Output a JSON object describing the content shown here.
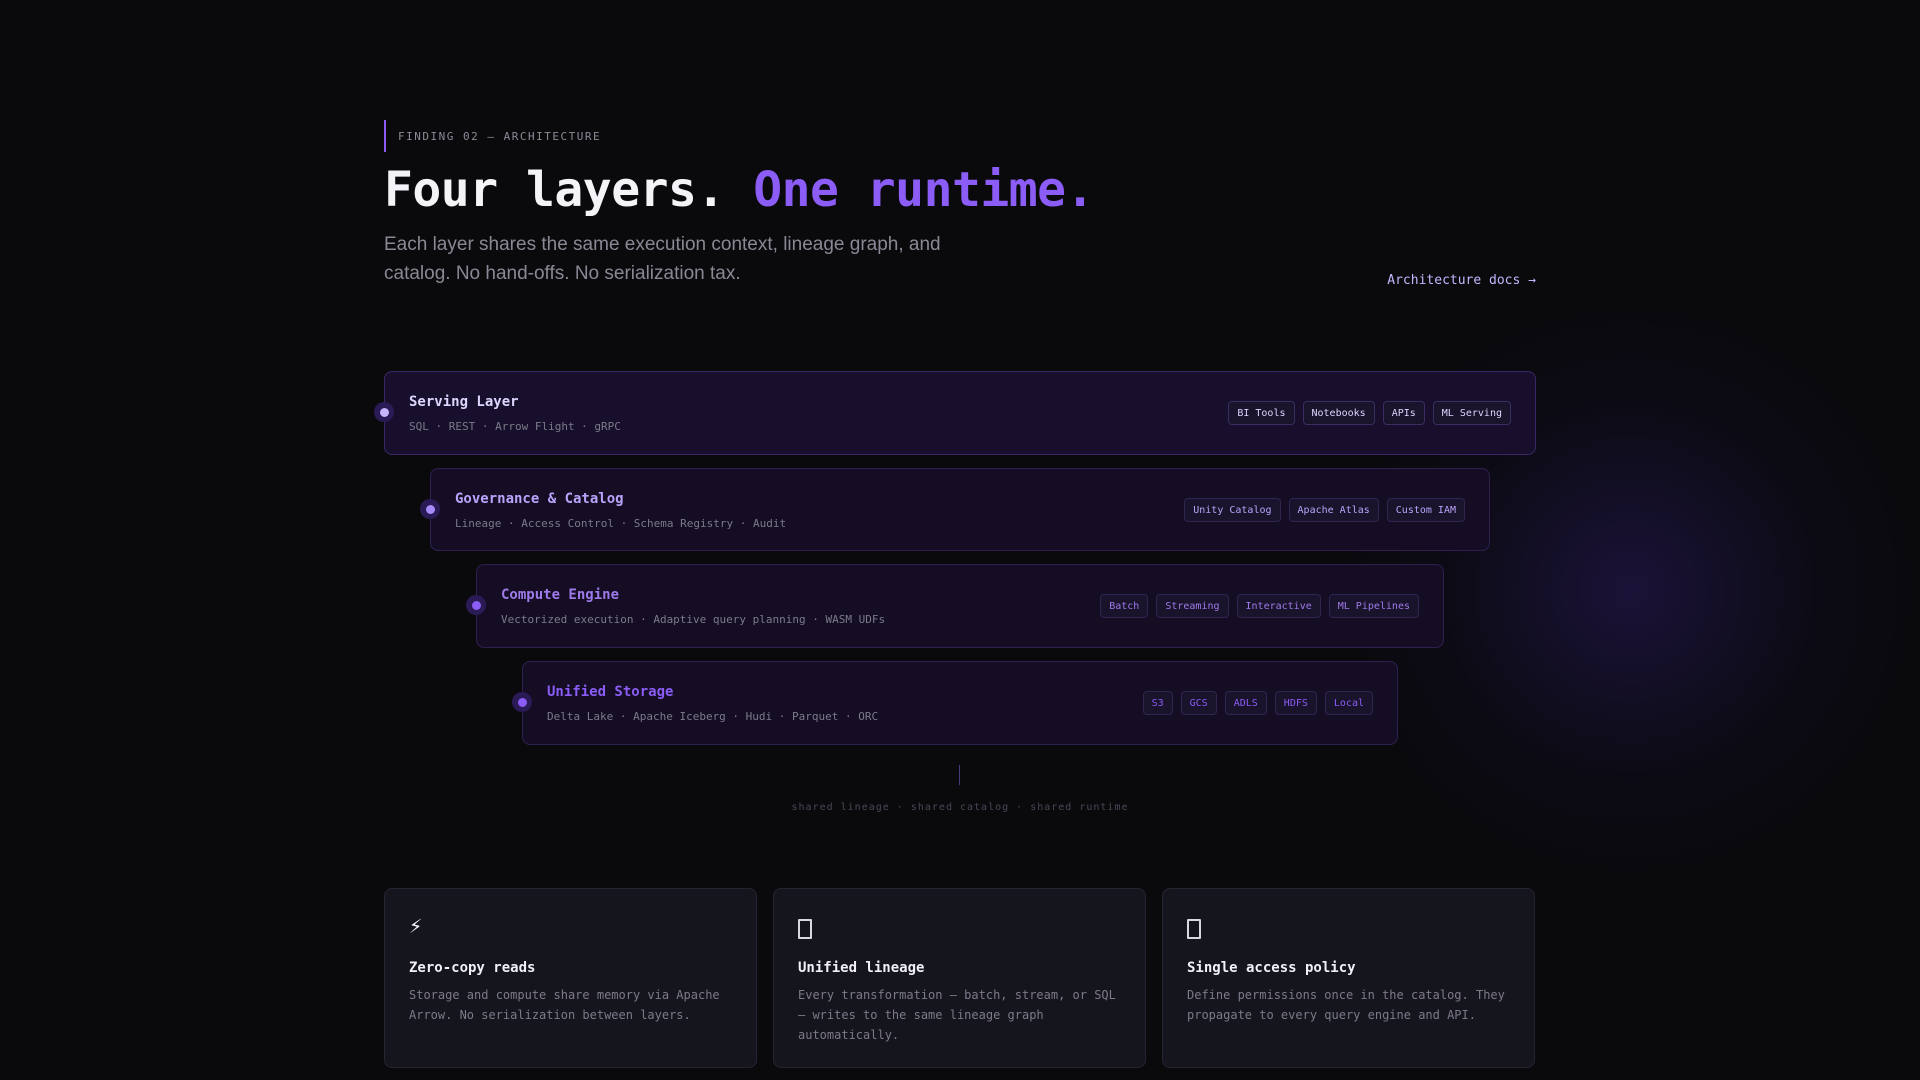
{
  "header": {
    "eyebrow": "FINDING 02 — ARCHITECTURE",
    "headline_plain": "Four layers.",
    "headline_accent": "One runtime.",
    "subhead": "Each layer shares the same execution context, lineage graph, and catalog. No hand-offs. No serialization tax.",
    "docs_link": "Architecture docs →"
  },
  "layers": [
    {
      "title": "Serving Layer",
      "subtitle": "SQL · REST · Arrow Flight · gRPC",
      "tags": [
        "BI Tools",
        "Notebooks",
        "APIs",
        "ML Serving"
      ]
    },
    {
      "title": "Governance & Catalog",
      "subtitle": "Lineage · Access Control · Schema Registry · Audit",
      "tags": [
        "Unity Catalog",
        "Apache Atlas",
        "Custom IAM"
      ]
    },
    {
      "title": "Compute Engine",
      "subtitle": "Vectorized execution · Adaptive query planning · WASM UDFs",
      "tags": [
        "Batch",
        "Streaming",
        "Interactive",
        "ML Pipelines"
      ]
    },
    {
      "title": "Unified Storage",
      "subtitle": "Delta Lake · Apache Iceberg · Hudi · Parquet · ORC",
      "tags": [
        "S3",
        "GCS",
        "ADLS",
        "HDFS",
        "Local"
      ]
    }
  ],
  "shared_caption": "shared lineage · shared catalog · shared runtime",
  "cards": [
    {
      "icon": "lightning-icon",
      "glyph": "⚡",
      "title": "Zero-copy reads",
      "body": "Storage and compute share memory via Apache Arrow. No serialization between layers."
    },
    {
      "icon": "lineage-icon",
      "title": "Unified lineage",
      "body": "Every transformation — batch, stream, or SQL — writes to the same lineage graph automatically."
    },
    {
      "icon": "lock-icon",
      "title": "Single access policy",
      "body": "Define permissions once in the catalog. They propagate to every query engine and API."
    }
  ],
  "colors": {
    "background": "#0a0a0d",
    "accent": "#8b5cf6",
    "accent_light": "#c4b5fd",
    "muted_text": "#8a8894"
  }
}
